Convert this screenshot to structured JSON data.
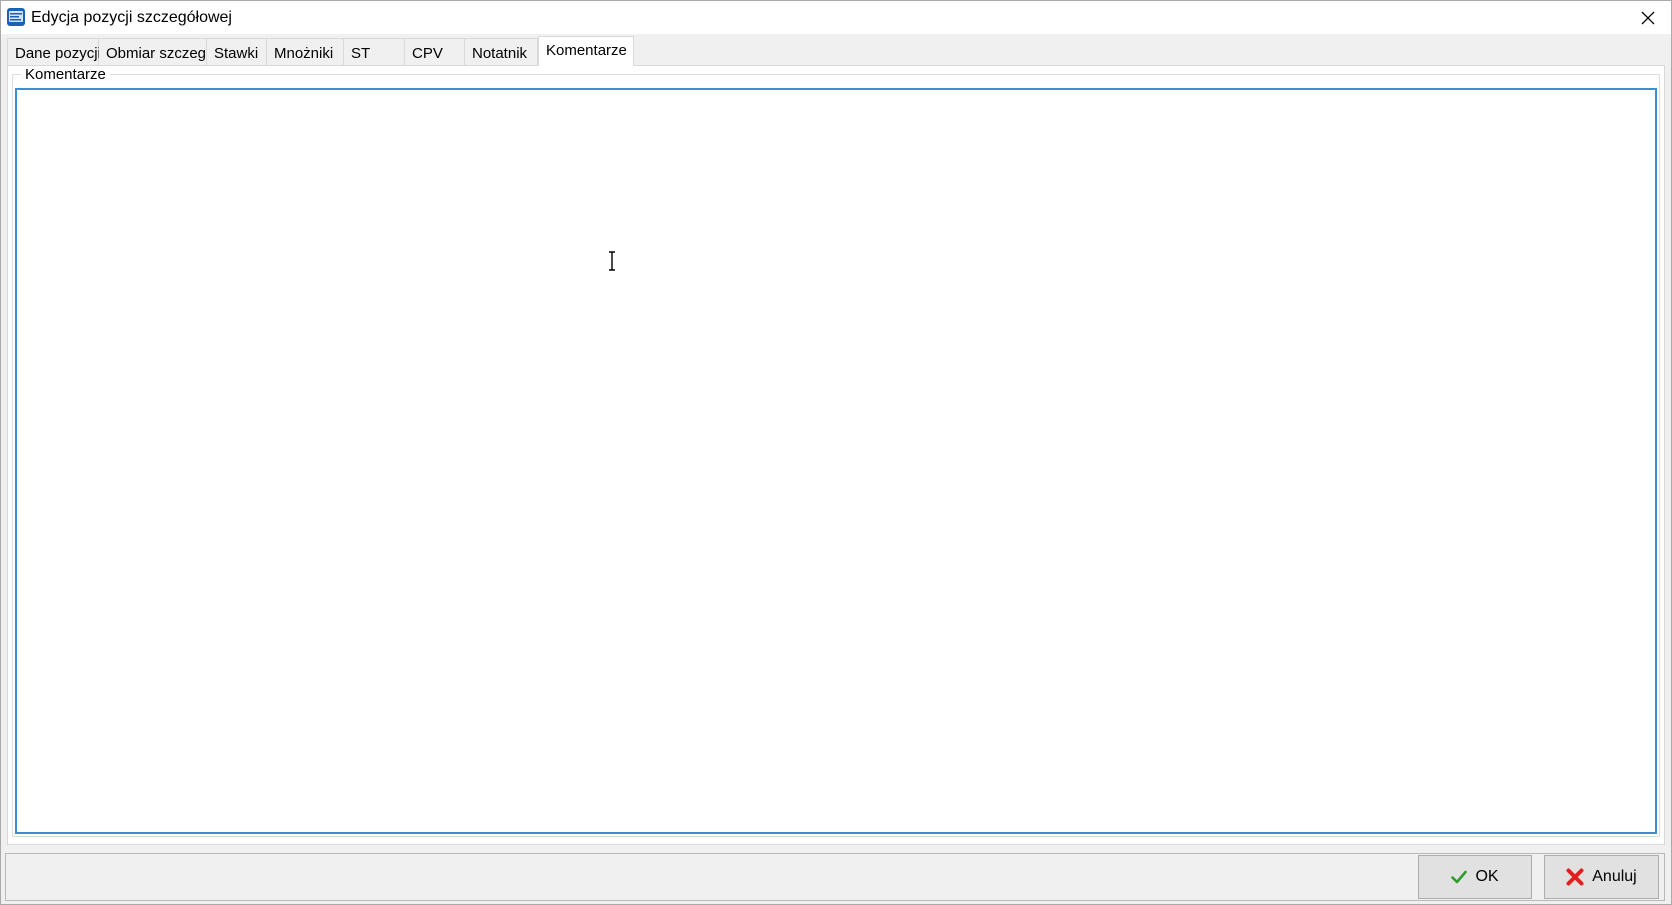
{
  "window": {
    "title": "Edycja pozycji szczegółowej"
  },
  "tabs": [
    {
      "label": "Dane pozycji",
      "active": false
    },
    {
      "label": "Obmiar szczeg.",
      "active": false
    },
    {
      "label": "Stawki",
      "active": false
    },
    {
      "label": "Mnożniki",
      "active": false
    },
    {
      "label": "ST",
      "active": false
    },
    {
      "label": "CPV",
      "active": false
    },
    {
      "label": "Notatnik",
      "active": false
    },
    {
      "label": "Komentarze",
      "active": true
    }
  ],
  "comments": {
    "group_label": "Komentarze",
    "value": ""
  },
  "buttons": {
    "ok_label": "OK",
    "cancel_label": "Anuluj"
  },
  "colors": {
    "focus_border": "#3c8fd6",
    "ok_check": "#2e9d2e",
    "cancel_x": "#e02020"
  },
  "icons": {
    "app": "app-icon",
    "close": "close-icon",
    "ok": "checkmark-icon",
    "cancel": "x-icon"
  }
}
